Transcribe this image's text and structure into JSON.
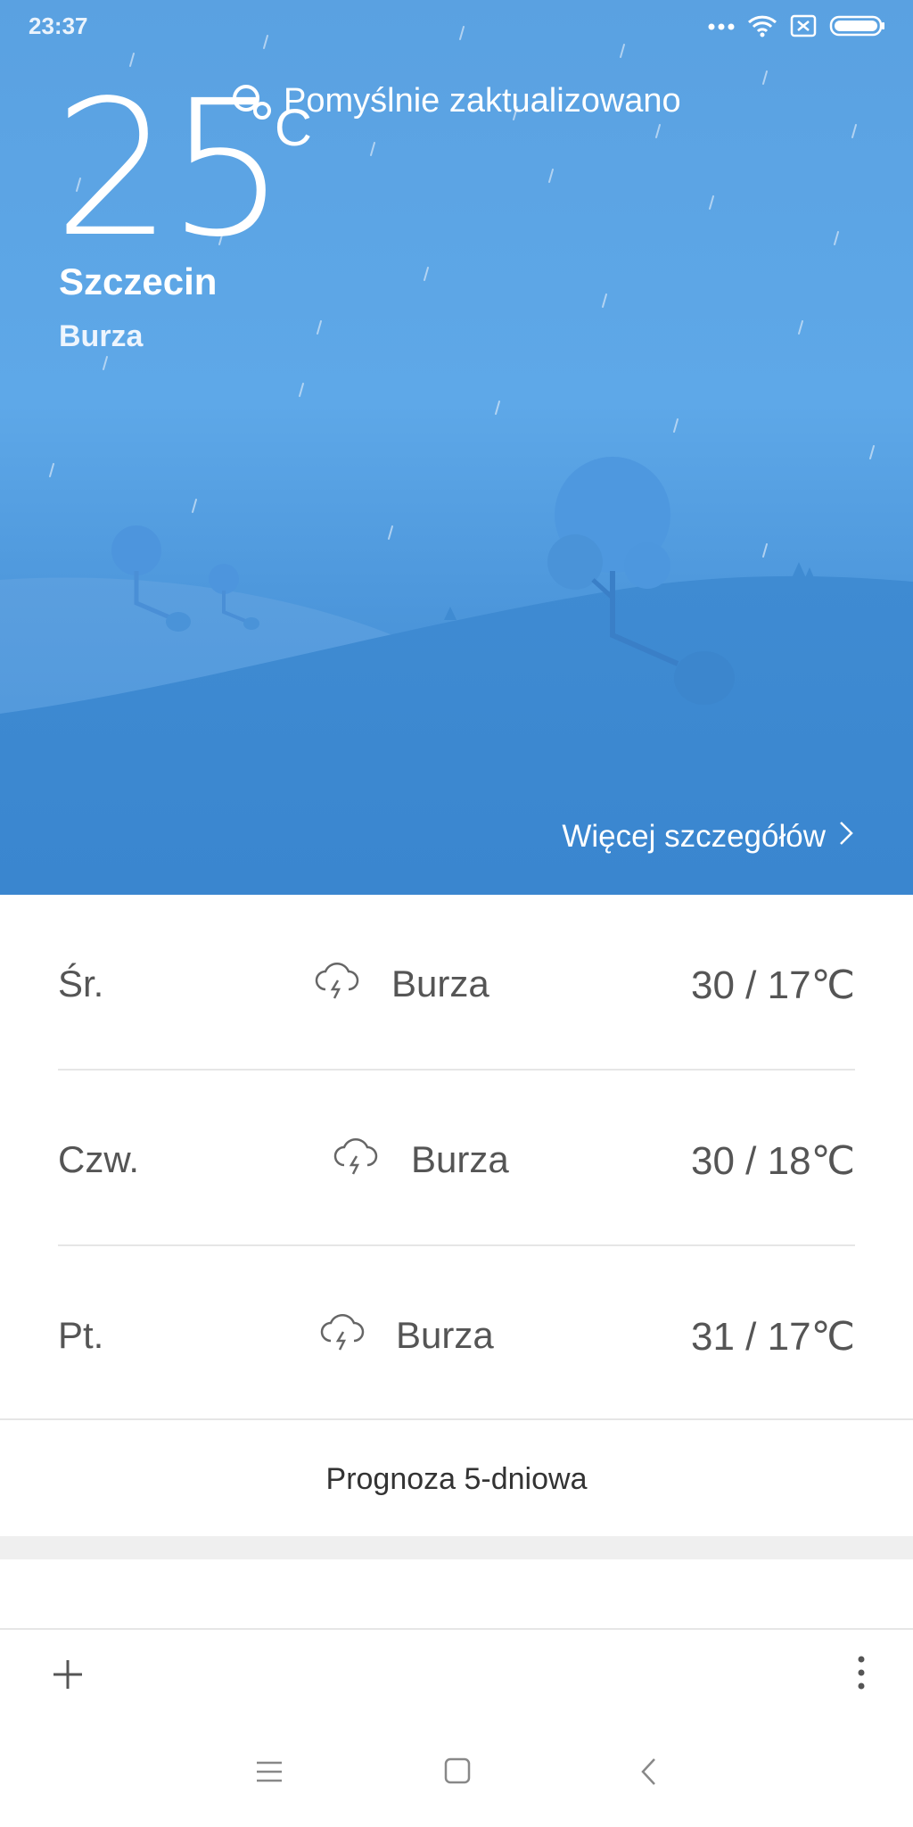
{
  "status_bar": {
    "time": "23:37",
    "icons": [
      "more-dots-icon",
      "wifi-icon",
      "sim-x-icon",
      "battery-icon"
    ]
  },
  "current": {
    "temperature": "25",
    "unit": "C",
    "update_status": "Pomyślnie zaktualizowano",
    "city": "Szczecin",
    "condition": "Burza"
  },
  "more_details_label": "Więcej szczegółów",
  "forecast": [
    {
      "day": "Śr.",
      "icon": "thunderstorm-icon",
      "condition": "Burza",
      "range": "30 / 17℃"
    },
    {
      "day": "Czw.",
      "icon": "thunderstorm-icon",
      "condition": "Burza",
      "range": "30 / 18℃"
    },
    {
      "day": "Pt.",
      "icon": "thunderstorm-icon",
      "condition": "Burza",
      "range": "31 / 17℃"
    }
  ],
  "five_day_label": "Prognoza 5-dniowa",
  "bottom_actions": [
    "add-icon",
    "more-vertical-icon"
  ],
  "nav": [
    "menu-icon",
    "home-icon",
    "back-icon"
  ],
  "colors": {
    "sky": "#5ea8e8",
    "hill": "#3d88d1",
    "text_gray": "#555555"
  }
}
